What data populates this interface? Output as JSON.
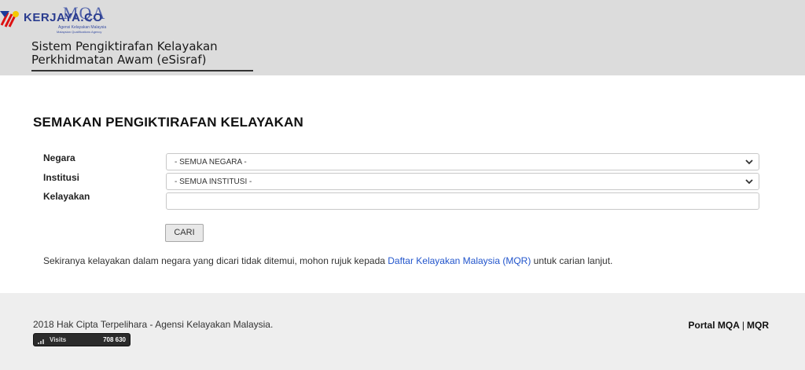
{
  "header": {
    "watermark": "KERJAYA.CO",
    "logo": {
      "text": "MQA",
      "subtitle": "Agensi Kelayakan Malaysia",
      "tagline": "Malaysian Qualifications Agency"
    },
    "system_title_line1": "Sistem Pengiktirafan Kelayakan",
    "system_title_line2": "Perkhidmatan Awam (eSisraf)"
  },
  "main": {
    "title": "SEMAKAN PENGIKTIRAFAN KELAYAKAN",
    "form": {
      "negara_label": "Negara",
      "negara_value": "- SEMUA NEGARA -",
      "institusi_label": "Institusi",
      "institusi_value": "- SEMUA INSTITUSI -",
      "kelayakan_label": "Kelayakan",
      "kelayakan_value": "",
      "submit_label": "CARI"
    },
    "note": {
      "before": "Sekiranya kelayakan dalam negara yang dicari tidak ditemui, mohon rujuk kepada ",
      "link": "Daftar Kelayakan Malaysia (MQR)",
      "after": " untuk carian lanjut."
    }
  },
  "footer": {
    "copyright": "2018 Hak Cipta Terpelihara - Agensi Kelayakan Malaysia.",
    "visits_label": "Visits",
    "visits_count": "708 630",
    "link_portal": "Portal MQA",
    "separator": "|",
    "link_mqr": "MQR"
  },
  "icons": {
    "select_arrow": "chevron-down-icon",
    "visits": "bar-chart-icon",
    "watermark": "flag-icon"
  },
  "colors": {
    "header_bg": "#dcdcdc",
    "footer_bg": "#eeeeee",
    "link": "#2255cc",
    "brand": "#3a4fa3"
  }
}
